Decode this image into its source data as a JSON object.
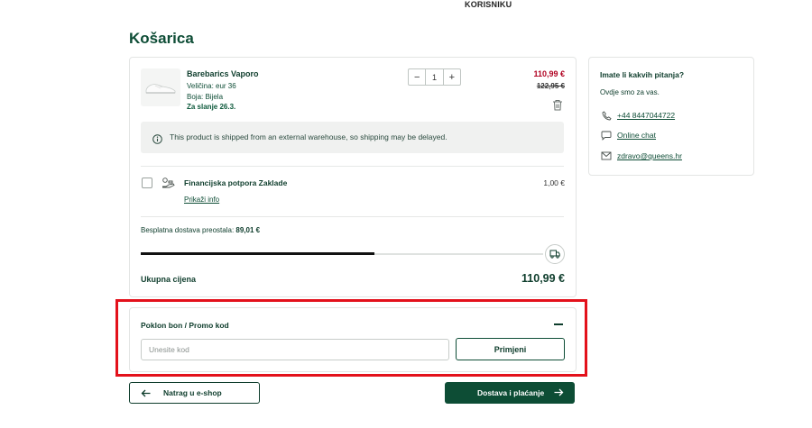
{
  "header": {
    "nav_link": "KORISNIKU"
  },
  "page": {
    "title": "Košarica"
  },
  "cart": {
    "item": {
      "name": "Barebarics Vaporo",
      "size": "Veličina: eur 36",
      "color": "Boja: Bijela",
      "shipping": "Za slanje 26.3.",
      "quantity": "1",
      "price": "110,99 €",
      "old_price": "122,95 €",
      "notice": "This product is shipped from an external warehouse, so shipping may be delayed."
    },
    "donation": {
      "name": "Financijska potpora Zaklade",
      "link": "Prikaži info",
      "price": "1,00 €"
    },
    "free_shipping": {
      "label": "Besplatna dostava preostala:",
      "amount": "89,01 €",
      "progress": 0.58
    },
    "total": {
      "label": "Ukupna cijena",
      "value": "110,99 €"
    }
  },
  "help": {
    "title": "Imate li kakvih pitanja?",
    "subtitle": "Ovdje smo za vas.",
    "phone": "+44 8447044722",
    "chat": "Online chat",
    "email": "zdravo@queens.hr"
  },
  "promo": {
    "title": "Poklon bon / Promo kod",
    "placeholder": "Unesite kod",
    "apply_label": "Primjeni"
  },
  "actions": {
    "back_label": "Natrag u e-shop",
    "next_label": "Dostava i plaćanje"
  },
  "colors": {
    "brand_green": "#0d4d35",
    "sale_red": "#b00020",
    "highlight_red": "#e3111b"
  }
}
